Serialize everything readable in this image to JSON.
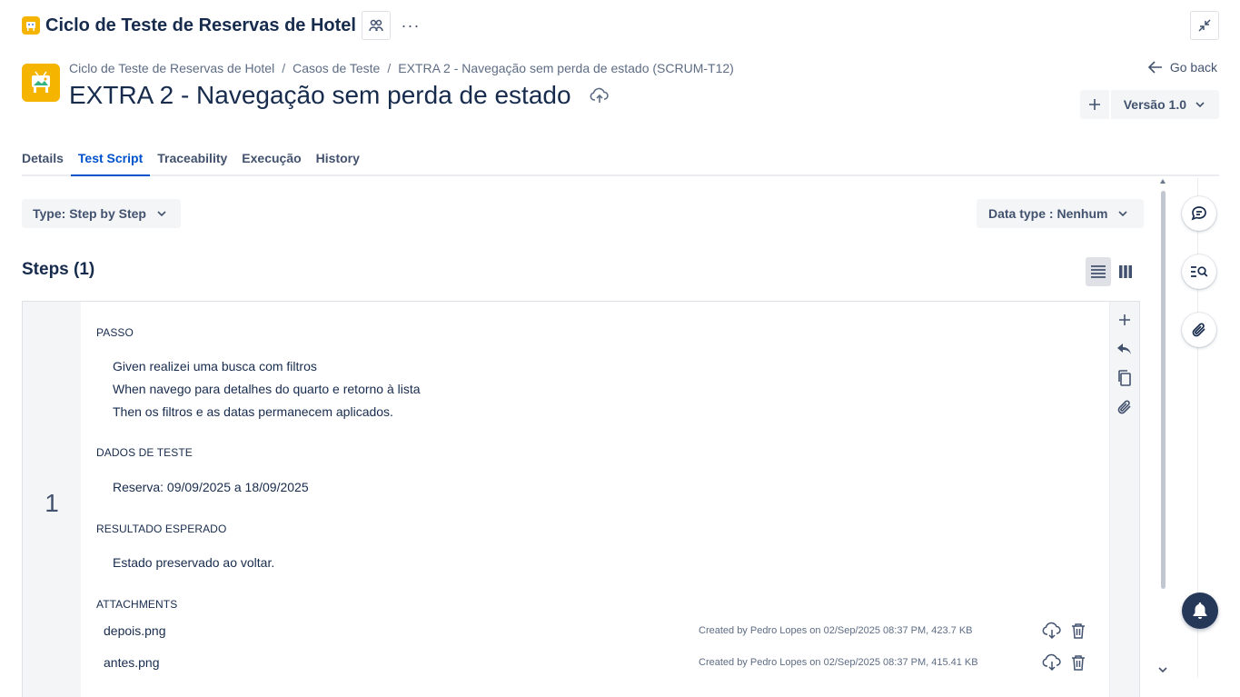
{
  "header": {
    "app_title": "Ciclo de Teste de Reservas de Hotel",
    "more_label": "···"
  },
  "breadcrumb": {
    "items": [
      "Ciclo de Teste de Reservas de Hotel",
      "Casos de Teste",
      "EXTRA 2 - Navegação sem perda de estado (SCRUM-T12)"
    ],
    "separator": "/"
  },
  "case": {
    "title": "EXTRA 2 - Navegação sem perda de estado"
  },
  "actions": {
    "go_back": "Go back",
    "version_label": "Versão 1.0"
  },
  "tabs": [
    {
      "label": "Details",
      "active": false
    },
    {
      "label": "Test Script",
      "active": true
    },
    {
      "label": "Traceability",
      "active": false
    },
    {
      "label": "Execução",
      "active": false
    },
    {
      "label": "History",
      "active": false
    }
  ],
  "script": {
    "type_label": "Type: Step by Step",
    "data_type_label": "Data type : Nenhum",
    "steps_heading": "Steps (1)"
  },
  "step": {
    "number": "1",
    "passo_label": "PASSO",
    "passo_lines": [
      "Given realizei uma busca com filtros",
      "When navego para detalhes do quarto e retorno à lista",
      "Then os filtros e as datas permanecem aplicados."
    ],
    "dados_label": "DADOS DE TESTE",
    "dados_value": "Reserva: 09/09/2025 a 18/09/2025",
    "resultado_label": "RESULTADO ESPERADO",
    "resultado_value": "Estado preservado ao voltar.",
    "attachments_label": "ATTACHMENTS",
    "attachments": [
      {
        "name": "depois.png",
        "meta": "Created by Pedro Lopes on 02/Sep/2025 08:37 PM, 423.7 KB"
      },
      {
        "name": "antes.png",
        "meta": "Created by Pedro Lopes on 02/Sep/2025 08:37 PM, 415.41 KB"
      }
    ]
  },
  "colors": {
    "accent": "#0052cc",
    "logo": "#f5b400",
    "text": "#172b4d",
    "muted": "#42526e",
    "notification_bg": "#253858"
  },
  "icons": [
    "app-logo-icon",
    "people-icon",
    "more-icon",
    "minimize-icon",
    "arrow-left-icon",
    "plus-icon",
    "chevron-down-icon",
    "cloud-upload-icon",
    "list-view-icon",
    "column-view-icon",
    "undo-icon",
    "copy-icon",
    "paperclip-icon",
    "cloud-download-icon",
    "trash-icon",
    "comment-icon",
    "search-list-icon",
    "bell-icon"
  ]
}
